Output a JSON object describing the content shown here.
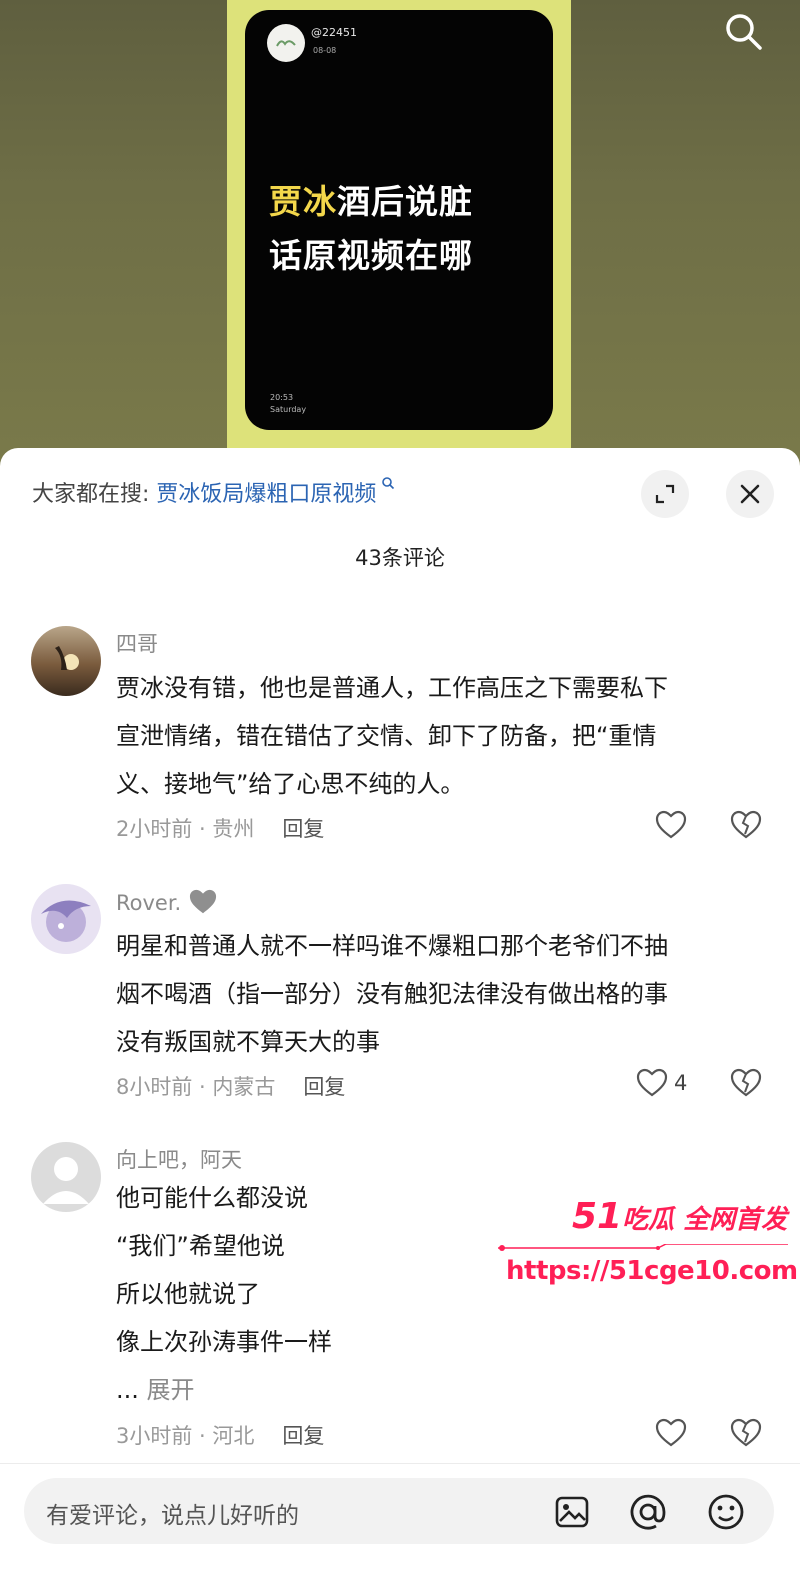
{
  "video": {
    "handle": "@22451",
    "date": "08-08",
    "title_highlight": "贾冰",
    "title_rest1": "酒后说脏",
    "title_line2": "话原视频在哪",
    "time": "20:53",
    "weekday": "Saturday"
  },
  "sheet": {
    "search_prefix": "大家都在搜: ",
    "search_term": "贾冰饭局爆粗口原视频",
    "comment_count": "43条评论"
  },
  "comments": [
    {
      "name": "四哥",
      "lines": [
        "贾冰没有错，他也是普通人，工作高压之下需要私下",
        "宣泄情绪，错在错估了交情、卸下了防备，把“重情",
        "义、接地气”给了心思不纯的人。"
      ],
      "time_loc": "2小时前 · 贵州",
      "reply": "回复",
      "likes": ""
    },
    {
      "name": "Rover.",
      "lines": [
        "明星和普通人就不一样吗谁不爆粗口那个老爷们不抽",
        "烟不喝酒（指一部分）没有触犯法律没有做出格的事",
        "没有叛国就不算天大的事"
      ],
      "time_loc": "8小时前 · 内蒙古",
      "reply": "回复",
      "likes": "4"
    },
    {
      "name": "向上吧，阿天",
      "lines": [
        "他可能什么都没说",
        "“我们”希望他说",
        "所以他就说了",
        "像上次孙涛事件一样"
      ],
      "ellipsis": "... ",
      "expand": "展开",
      "time_loc": "3小时前 · 河北",
      "reply": "回复",
      "likes": ""
    }
  ],
  "watermark": {
    "num": "51",
    "text": "吃瓜 全网首发",
    "url": "https://51cge10.com"
  },
  "input": {
    "placeholder": "有爱评论，说点儿好听的"
  },
  "colors": {
    "link": "#2b64b3",
    "highlight": "#f3d74b",
    "watermark": "#ff1f56"
  }
}
